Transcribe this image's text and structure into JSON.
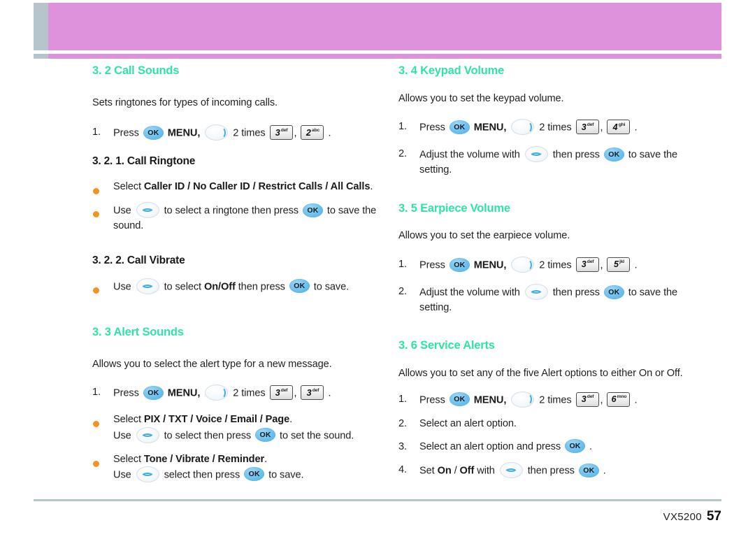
{
  "header": {
    "tab_color": "#b5c5cb",
    "band_color": "#dd92db"
  },
  "theme": {
    "heading_color": "#2fe3ab",
    "bullet_color": "#f6921e",
    "ok_key_color": "#6cc0ee",
    "rule_color": "#b5c5cb"
  },
  "glyphs": {
    "ok": "OK",
    "nav_lr": "nav-left-right-key",
    "nav_ud": "nav-up-down-key",
    "key3": {
      "digit": "3",
      "letters": "def"
    },
    "key2": {
      "digit": "2",
      "letters": "abc"
    },
    "key4": {
      "digit": "4",
      "letters": "ghi"
    },
    "key5": {
      "digit": "5",
      "letters": "jkl"
    },
    "key6": {
      "digit": "6",
      "letters": "mno"
    }
  },
  "left_column": {
    "section_call_sounds": {
      "heading": "3. 2 Call Sounds",
      "intro": "Sets ringtones for types of incoming calls.",
      "step1": {
        "marker": "1.",
        "press": "Press",
        "menu": "MENU,",
        "times": "2 times",
        "comma": ",",
        "period": "."
      },
      "sub_call_ringtone": {
        "heading": "3. 2. 1. Call Ringtone",
        "bullet1_pre": "Select ",
        "bullet1_bold": "Caller ID / No Caller ID / Restrict Calls / All Calls",
        "bullet1_post": ".",
        "bullet2_pre": "Use ",
        "bullet2_mid": " to select a ringtone then press ",
        "bullet2_post": " to save the sound."
      },
      "sub_call_vibrate": {
        "heading": "3. 2. 2. Call Vibrate",
        "bullet1_pre": "Use ",
        "bullet1_mid": " to select ",
        "bullet1_bold": "On/Off",
        "bullet1_mid2": " then press ",
        "bullet1_post": " to save."
      }
    },
    "section_alert_sounds": {
      "heading": "3. 3 Alert Sounds",
      "intro": "Allows you to select the alert type for a new message.",
      "step1": {
        "marker": "1.",
        "press": "Press",
        "menu": "MENU,",
        "times": "2 times",
        "comma": ",",
        "period": "."
      },
      "bullet1_pre": "Select ",
      "bullet1_bold": "PIX / TXT / Voice / Email / Page",
      "bullet1_post": ".",
      "bullet1_cont_pre": "Use ",
      "bullet1_cont_mid": " to select then press ",
      "bullet1_cont_post": " to set the sound.",
      "bullet2_pre": "Select ",
      "bullet2_bold": "Tone / Vibrate / Reminder",
      "bullet2_post": ".",
      "bullet2_cont_pre": "Use ",
      "bullet2_cont_mid": " select then press ",
      "bullet2_cont_post": " to save."
    }
  },
  "right_column": {
    "section_keypad_volume": {
      "heading": "3. 4 Keypad Volume",
      "intro": "Allows you to set the keypad volume.",
      "step1": {
        "marker": "1.",
        "press": "Press",
        "menu": "MENU,",
        "times": "2 times",
        "comma": ",",
        "period": "."
      },
      "step2": {
        "marker": "2.",
        "pre": "Adjust the volume with ",
        "mid": " then press ",
        "post": " to save the setting."
      }
    },
    "section_earpiece_volume": {
      "heading": "3. 5 Earpiece Volume",
      "intro": "Allows you to set the earpiece volume.",
      "step1": {
        "marker": "1.",
        "press": "Press",
        "menu": "MENU,",
        "times": "2 times",
        "comma": ",",
        "period": "."
      },
      "step2": {
        "marker": "2.",
        "pre": "Adjust the volume with ",
        "mid": " then press ",
        "post": " to save the setting."
      }
    },
    "section_service_alerts": {
      "heading": "3. 6 Service Alerts",
      "intro": "Allows you to set any of the five Alert options to either On or Off.",
      "step1": {
        "marker": "1.",
        "press": "Press",
        "menu": "MENU,",
        "times": "2 times",
        "comma": ",",
        "period": "."
      },
      "step2": {
        "marker": "2.",
        "text": "Select an alert option."
      },
      "step3": {
        "marker": "3.",
        "pre": "Select an alert option and press ",
        "post": "."
      },
      "step4": {
        "marker": "4.",
        "pre": "Set ",
        "bold_on": "On",
        "slash": " / ",
        "bold_off": "Off",
        "mid": " with ",
        "mid2": " then press ",
        "post": "."
      }
    }
  },
  "footer": {
    "model": "VX5200",
    "page_number": "57"
  }
}
